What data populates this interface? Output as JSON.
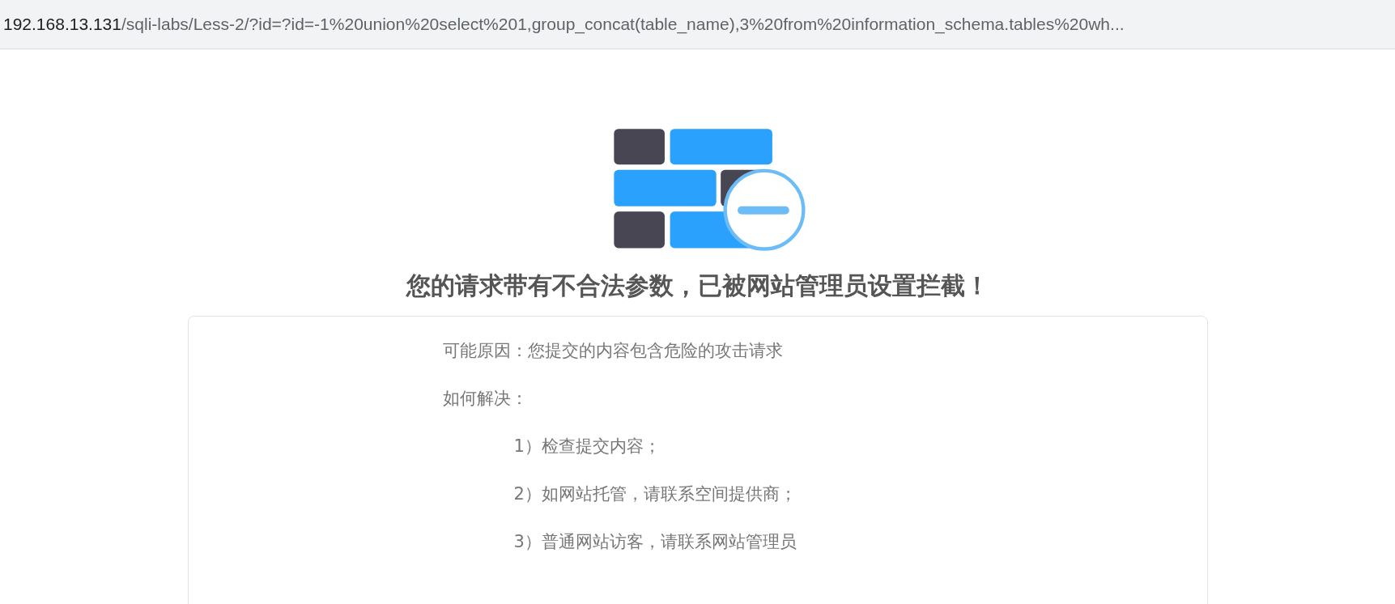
{
  "address_bar": {
    "host": "192.168.13.131",
    "path": "/sqli-labs/Less-2/?id=?id=-1%20union%20select%201,group_concat(table_name),3%20from%20information_schema.tables%20wh..."
  },
  "heading": "您的请求带有不合法参数，已被网站管理员设置拦截！",
  "reason": "可能原因：您提交的内容包含危险的攻击请求",
  "solution_label": "如何解决：",
  "steps": [
    "1）检查提交内容；",
    "2）如网站托管，请联系空间提供商；",
    "3）普通网站访客，请联系网站管理员"
  ]
}
